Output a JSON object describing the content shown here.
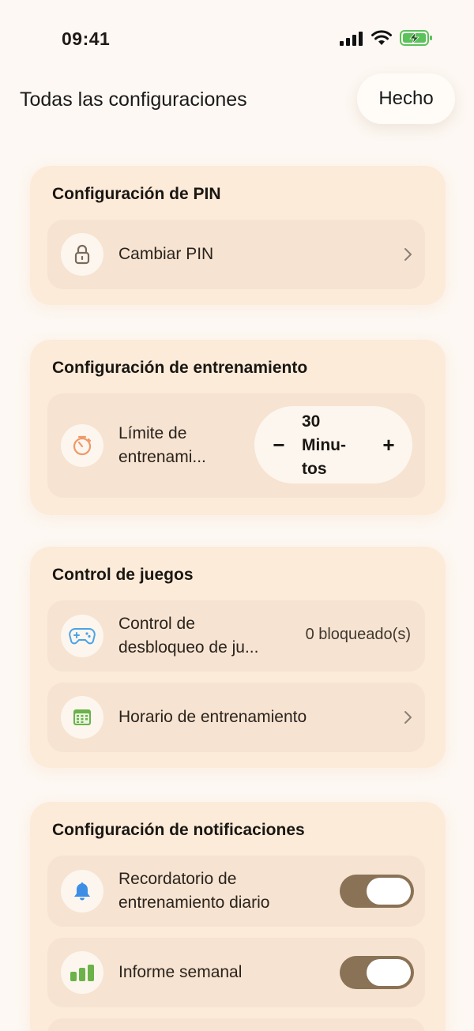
{
  "status": {
    "time": "09:41"
  },
  "header": {
    "title": "Todas las configuraciones",
    "done_label": "Hecho"
  },
  "pin_section": {
    "title": "Configuración de PIN",
    "change_pin": {
      "label": "Cambiar PIN",
      "icon": "lock-icon"
    }
  },
  "training_section": {
    "title": "Configuración de entrenamiento",
    "limit": {
      "label_line1": "Límite de",
      "label_line2": "entrenami...",
      "icon": "timer-icon",
      "minus": "−",
      "plus": "+",
      "value_line1": "30",
      "value_line2": "Minu-",
      "value_line3": "tos"
    }
  },
  "games_section": {
    "title": "Control de juegos",
    "unlock_control": {
      "label_line1": "Control de",
      "label_line2": "desbloqueo de ju...",
      "value": "0 bloqueado(s)",
      "icon": "gamepad-icon"
    },
    "schedule": {
      "label": "Horario de entrenamiento",
      "icon": "calendar-icon"
    }
  },
  "notifications_section": {
    "title": "Configuración de notificaciones",
    "daily_reminder": {
      "label_line1": "Recordatorio de",
      "label_line2": "entrenamiento diario",
      "icon": "bell-icon",
      "enabled": true
    },
    "weekly_report": {
      "label": "Informe semanal",
      "icon": "bar-chart-icon",
      "enabled": true
    }
  },
  "colors": {
    "background": "#fdf8f3",
    "card": "#fcebd9",
    "row": "#f6e3d1",
    "toggle_on": "#8a7256",
    "timer_accent": "#ef9868",
    "gamepad_accent": "#4aa3e8",
    "calendar_accent": "#6bb24a",
    "bell_accent": "#3d8fe6",
    "chart_accent": "#6bb24a"
  }
}
